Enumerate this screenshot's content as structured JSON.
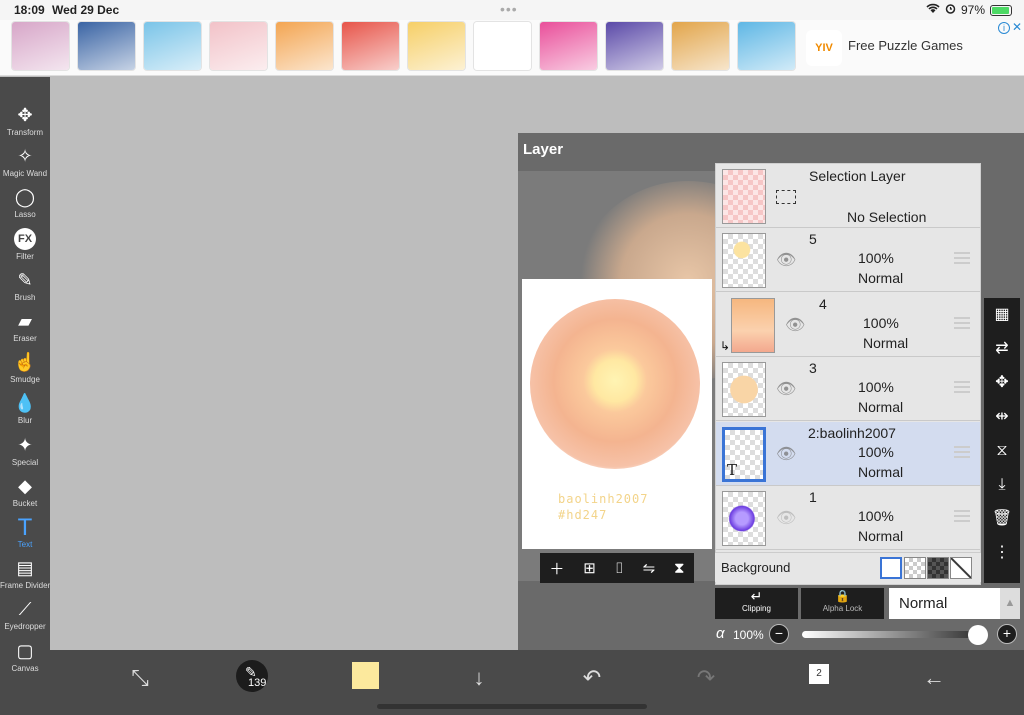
{
  "status": {
    "time": "18:09",
    "date": "Wed 29 Dec",
    "battery": "97%",
    "battery_level": 0.97
  },
  "ad": {
    "thumbs": [
      {
        "color": "#d7a6c8"
      },
      {
        "color": "#3a64a4"
      },
      {
        "color": "#7ac4e8"
      },
      {
        "color": "#f2c2c8"
      },
      {
        "color": "#f3a552"
      },
      {
        "color": "#e7554a"
      },
      {
        "color": "#f6cf67"
      },
      {
        "color": "#ffffff"
      },
      {
        "color": "#e94f9a"
      },
      {
        "color": "#5b4aa8"
      },
      {
        "color": "#e2a54b"
      },
      {
        "color": "#5fb7e5"
      }
    ],
    "brand_logo": "YIV",
    "title": "Free Puzzle Games",
    "info_icon": "i",
    "close_icon": "✕"
  },
  "tools": [
    {
      "label": "Transform",
      "icon": "move-icon"
    },
    {
      "label": "Magic Wand",
      "icon": "magic-wand-icon"
    },
    {
      "label": "Lasso",
      "icon": "lasso-icon"
    },
    {
      "label": "Filter",
      "icon": "fx-icon"
    },
    {
      "label": "Brush",
      "icon": "brush-icon"
    },
    {
      "label": "Eraser",
      "icon": "eraser-icon"
    },
    {
      "label": "Smudge",
      "icon": "smudge-icon"
    },
    {
      "label": "Blur",
      "icon": "blur-drop-icon"
    },
    {
      "label": "Special",
      "icon": "special-icon"
    },
    {
      "label": "Bucket",
      "icon": "bucket-icon"
    },
    {
      "label": "Text",
      "icon": "text-icon"
    },
    {
      "label": "Frame Divider",
      "icon": "frame-divider-icon"
    },
    {
      "label": "Eyedropper",
      "icon": "eyedropper-icon"
    },
    {
      "label": "Canvas",
      "icon": "canvas-icon"
    }
  ],
  "active_tool": "Text",
  "layer_panel": {
    "title": "Layer",
    "preview_signature": [
      "baolinh2007",
      "#hd247"
    ],
    "selection_layer": {
      "name": "Selection Layer",
      "status": "No Selection"
    },
    "layers": [
      {
        "name": "5",
        "opacity": "100%",
        "mode": "Normal",
        "visible": true,
        "selected": false
      },
      {
        "name": "4",
        "opacity": "100%",
        "mode": "Normal",
        "visible": true,
        "selected": false,
        "clipped": true
      },
      {
        "name": "3",
        "opacity": "100%",
        "mode": "Normal",
        "visible": true,
        "selected": false
      },
      {
        "name": "2:baolinh2007",
        "opacity": "100%",
        "mode": "Normal",
        "visible": true,
        "selected": true,
        "type_label": "T"
      },
      {
        "name": "1",
        "opacity": "100%",
        "mode": "Normal",
        "visible": false,
        "selected": false
      }
    ],
    "background_label": "Background",
    "clipping_label": "Clipping",
    "alpha_lock_label": "Alpha Lock",
    "blend_mode": "Normal",
    "alpha_symbol": "α",
    "alpha_value": "100%",
    "alpha_level": 1.0
  },
  "bottom": {
    "brush_size": "139",
    "pages_count": "2",
    "color": "#fce99d"
  }
}
